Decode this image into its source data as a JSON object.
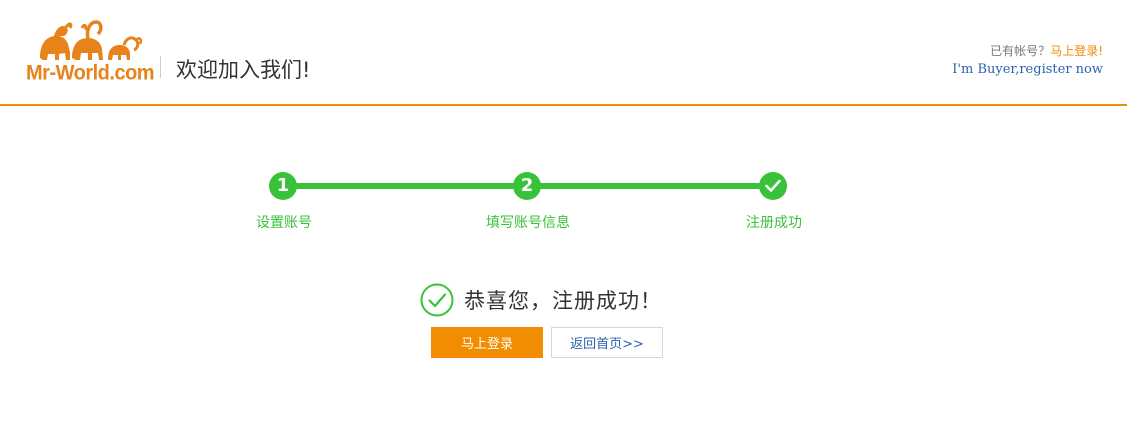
{
  "header": {
    "logo_text": "Mr-World.com",
    "welcome": "欢迎加入我们!",
    "has_account_text": "已有帐号？",
    "login_link": "马上登录!",
    "buyer_link": "I'm Buyer,register now"
  },
  "steps": [
    {
      "number": "1",
      "label": "设置账号",
      "status": "done"
    },
    {
      "number": "2",
      "label": "填写账号信息",
      "status": "done"
    },
    {
      "number": "",
      "label": "注册成功",
      "status": "current",
      "icon": "check-icon"
    }
  ],
  "success": {
    "icon": "check-circle-icon",
    "message": "恭喜您，注册成功！"
  },
  "buttons": {
    "login": "马上登录",
    "home": "返回首页>>"
  },
  "colors": {
    "accent": "#f28c00",
    "success": "#3ac13a",
    "link": "#2a61b0"
  }
}
